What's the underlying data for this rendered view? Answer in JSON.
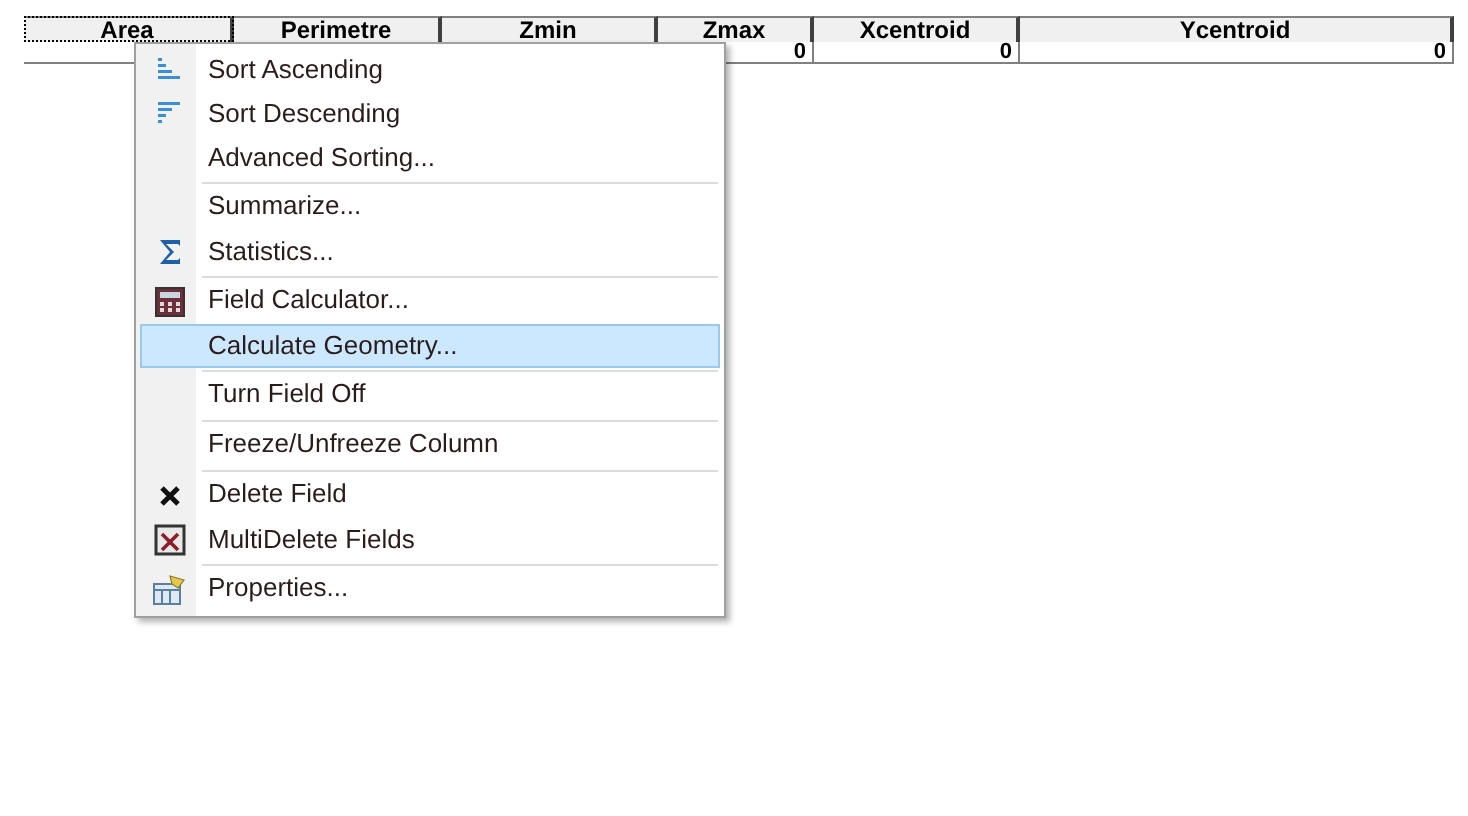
{
  "table": {
    "columns": [
      {
        "label": "Area",
        "focused": true
      },
      {
        "label": "Perimetre",
        "focused": false
      },
      {
        "label": "Zmin",
        "focused": false
      },
      {
        "label": "Zmax",
        "focused": false
      },
      {
        "label": "Xcentroid",
        "focused": false
      },
      {
        "label": "Ycentroid",
        "focused": false
      }
    ],
    "rows": [
      {
        "cells": [
          null,
          null,
          null,
          "0",
          "0",
          "0"
        ]
      }
    ]
  },
  "context_menu": {
    "items": [
      {
        "label": "Sort Ascending",
        "kind": "sortasc",
        "separator_before": false,
        "selected": false
      },
      {
        "label": "Sort Descending",
        "kind": "sortdesc",
        "separator_before": false,
        "selected": false
      },
      {
        "label": "Advanced Sorting...",
        "kind": "plain",
        "separator_before": false,
        "selected": false
      },
      {
        "label": "Summarize...",
        "kind": "plain",
        "separator_before": true,
        "selected": false
      },
      {
        "label": "Statistics...",
        "kind": "sigma",
        "separator_before": false,
        "selected": false
      },
      {
        "label": "Field Calculator...",
        "kind": "calculator",
        "separator_before": true,
        "selected": false
      },
      {
        "label": "Calculate Geometry...",
        "kind": "plain",
        "separator_before": false,
        "selected": true
      },
      {
        "label": "Turn Field Off",
        "kind": "plain",
        "separator_before": true,
        "selected": false
      },
      {
        "label": "Freeze/Unfreeze Column",
        "kind": "plain",
        "separator_before": true,
        "selected": false
      },
      {
        "label": "Delete Field",
        "kind": "delete",
        "separator_before": true,
        "selected": false
      },
      {
        "label": "MultiDelete Fields",
        "kind": "multidelete",
        "separator_before": false,
        "selected": false
      },
      {
        "label": "Properties...",
        "kind": "properties",
        "separator_before": true,
        "selected": false
      }
    ]
  }
}
